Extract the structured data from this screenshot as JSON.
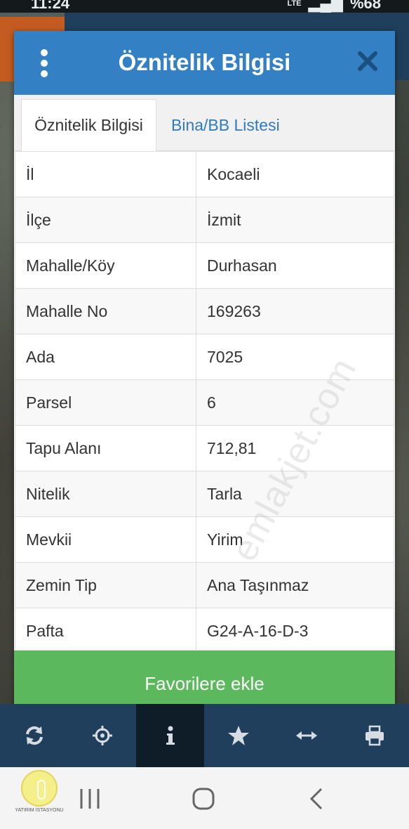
{
  "status_bar": {
    "time": "11:24",
    "network": "LTE",
    "battery": "%68"
  },
  "modal": {
    "title": "Öznitelik Bilgisi",
    "tabs": [
      {
        "label": "Öznitelik Bilgisi",
        "active": true
      },
      {
        "label": "Bina/BB Listesi",
        "active": false
      }
    ],
    "rows": [
      {
        "key": "İl",
        "value": "Kocaeli"
      },
      {
        "key": "İlçe",
        "value": "İzmit"
      },
      {
        "key": "Mahalle/Köy",
        "value": "Durhasan"
      },
      {
        "key": "Mahalle No",
        "value": "169263"
      },
      {
        "key": "Ada",
        "value": "7025"
      },
      {
        "key": "Parsel",
        "value": "6"
      },
      {
        "key": "Tapu Alanı",
        "value": "712,81"
      },
      {
        "key": "Nitelik",
        "value": "Tarla"
      },
      {
        "key": "Mevkii",
        "value": "Yirim"
      },
      {
        "key": "Zemin Tip",
        "value": "Ana Taşınmaz"
      },
      {
        "key": "Pafta",
        "value": "G24-A-16-D-3"
      }
    ],
    "favorite_button": "Favorilere ekle"
  },
  "watermark": "emlakjet.com",
  "logo": {
    "text": "YATIRIM İSTASYONU"
  },
  "toolbar": {
    "items": [
      "refresh-icon",
      "crosshair-icon",
      "info-icon",
      "star-icon",
      "measure-icon",
      "print-icon"
    ],
    "active": "info-icon"
  },
  "colors": {
    "header": "#3480c4",
    "favorite": "#5cb85c",
    "toolbar": "#1f3f5c",
    "tab_link": "#2f7bbf"
  }
}
